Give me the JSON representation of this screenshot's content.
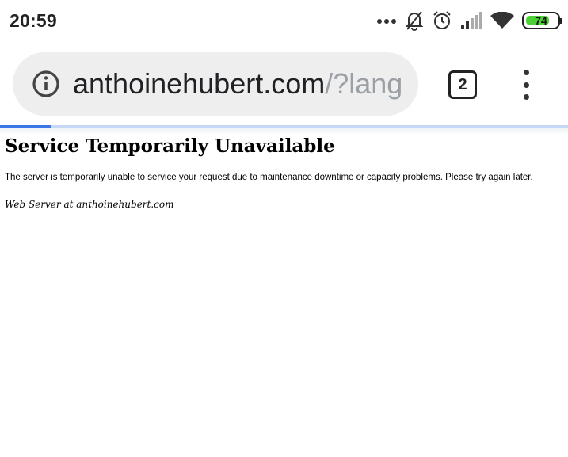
{
  "status_bar": {
    "time": "20:59",
    "battery_level": "74",
    "icons": [
      "more-dots-icon",
      "bell-off-icon",
      "alarm-clock-icon",
      "cell-signal-icon",
      "wifi-icon",
      "battery-icon"
    ]
  },
  "toolbar": {
    "url_host": "anthoinehubert.com",
    "url_path": "/?lang",
    "tab_count": "2",
    "info_icon": "info-icon",
    "menu_icon": "more-vert-icon"
  },
  "progress": {
    "fraction": 0.09,
    "color": "#3b78e7"
  },
  "page": {
    "heading": "Service Temporarily Unavailable",
    "message": "The server is temporarily unable to service your request due to maintenance downtime or capacity problems. Please try again later.",
    "footer": "Web Server at anthoinehubert.com"
  }
}
